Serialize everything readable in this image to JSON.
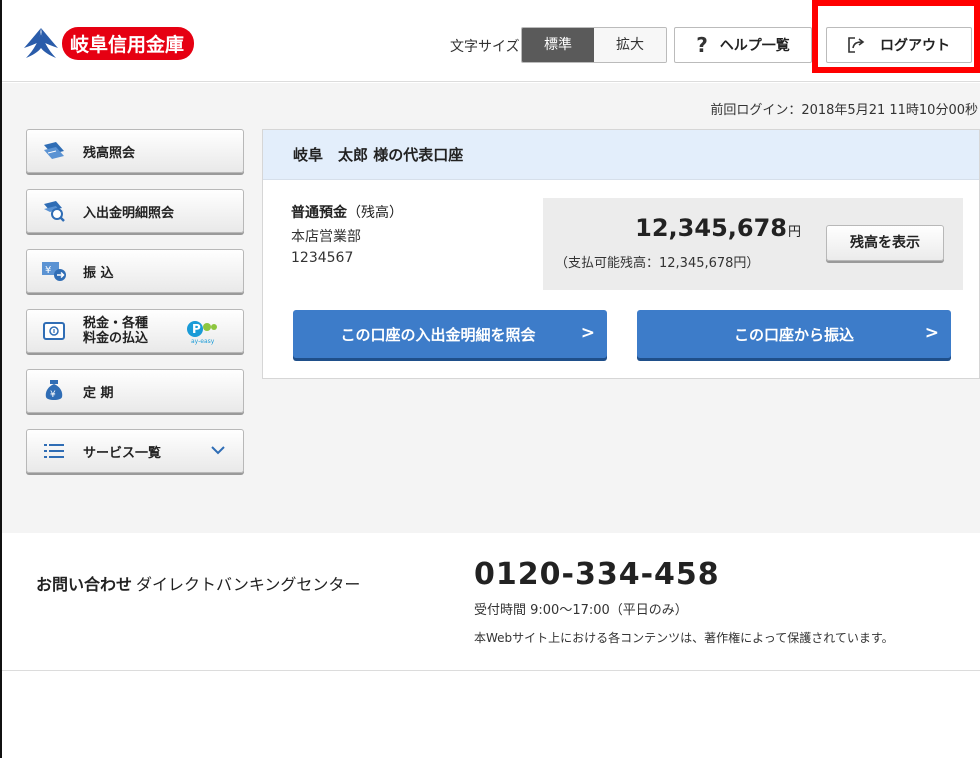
{
  "header": {
    "logo_text": "岐阜信用金庫",
    "font_size_label": "文字サイズ",
    "font_size_options": [
      "標準",
      "拡大"
    ],
    "help_label": "ヘルプ一覧",
    "logout_label": "ログアウト"
  },
  "last_login": "前回ログイン：2018年5月21 11時10分00秒",
  "sidebar": {
    "items": [
      {
        "label": "残高照会",
        "icon": "balance-inquiry-icon"
      },
      {
        "label": "入出金明細照会",
        "icon": "statement-search-icon"
      },
      {
        "label": "振 込",
        "icon": "transfer-icon"
      },
      {
        "label": "税金・各種\n料金の払込",
        "icon": "tax-payment-icon",
        "badge": "Pay-easy"
      },
      {
        "label": "定 期",
        "icon": "time-deposit-icon"
      },
      {
        "label": "サービス一覧",
        "icon": "list-icon"
      }
    ]
  },
  "account": {
    "title": "岐阜　太郎 様の代表口座",
    "type": "普通預金",
    "type_note": "（残高）",
    "branch": "本店営業部",
    "number": "1234567",
    "balance": "12,345,678",
    "balance_unit": "円",
    "available": "（支払可能残高：12,345,678円）",
    "show_balance_label": "残高を表示",
    "history_button": "この口座の入出金明細を照会",
    "transfer_button": "この口座から振込"
  },
  "footer": {
    "contact_label": "お問い合わせ",
    "contact_center": "ダイレクトバンキングセンター",
    "phone": "0120-334-458",
    "hours": "受付時間 9:00～17:00（平日のみ）",
    "copyright": "本Webサイト上における各コンテンツは、著作権によって保護されています。"
  },
  "colors": {
    "brand_red": "#e60012",
    "button_blue": "#3d7cc9",
    "panel_header": "#e3eefb",
    "highlight_red": "#ff0000"
  }
}
